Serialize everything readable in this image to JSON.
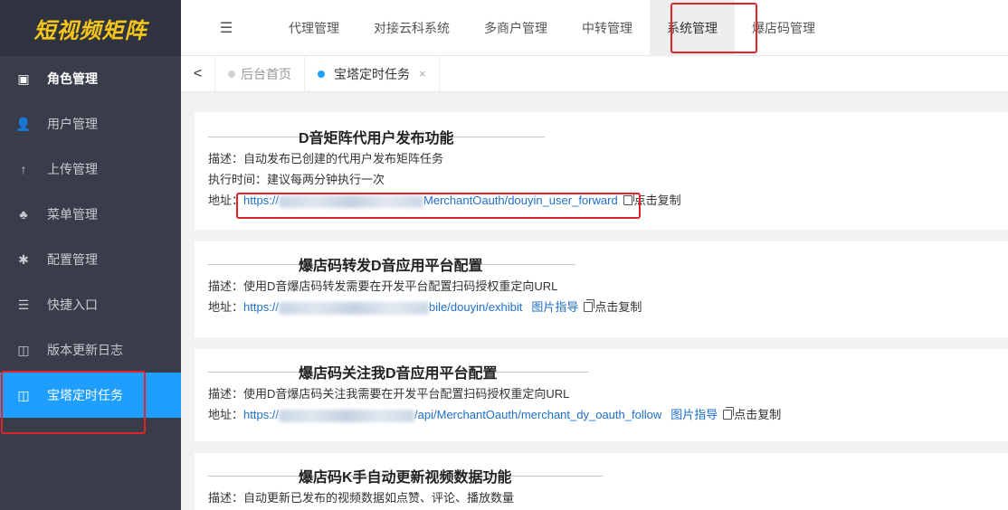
{
  "app": {
    "logo_text": "短视频矩阵"
  },
  "sidebar": {
    "items": [
      {
        "label": "角色管理",
        "icon": "id-card-icon",
        "glyph": "▣"
      },
      {
        "label": "用户管理",
        "icon": "user-icon",
        "glyph": "👤"
      },
      {
        "label": "上传管理",
        "icon": "upload-icon",
        "glyph": "↑"
      },
      {
        "label": "菜单管理",
        "icon": "tree-icon",
        "glyph": "♣"
      },
      {
        "label": "配置管理",
        "icon": "settings-icon",
        "glyph": "✱"
      },
      {
        "label": "快捷入口",
        "icon": "list-icon",
        "glyph": "☰"
      },
      {
        "label": "版本更新日志",
        "icon": "columns-icon",
        "glyph": "◫"
      },
      {
        "label": "宝塔定时任务",
        "icon": "columns-icon",
        "glyph": "◫"
      }
    ]
  },
  "topnav": {
    "toggle_glyph": "☰",
    "items": [
      {
        "label": "代理管理"
      },
      {
        "label": "对接云科系统"
      },
      {
        "label": "多商户管理"
      },
      {
        "label": "中转管理"
      },
      {
        "label": "系统管理"
      },
      {
        "label": "爆店码管理"
      }
    ]
  },
  "tabs": {
    "prev_glyph": "<",
    "items": [
      {
        "label": "后台首页"
      },
      {
        "label": "宝塔定时任务",
        "close": "×"
      }
    ]
  },
  "cards": [
    {
      "title": "D音矩阵代用户发布功能",
      "desc_label": "描述：",
      "desc": "自动发布已创建的代用户发布矩阵任务",
      "time_label": "执行时间：",
      "time": "建议每两分钟执行一次",
      "addr_label": "地址：",
      "url_prefix": "https://",
      "url_suffix": "MerchantOauth/douyin_user_forward",
      "copy_label": "点击复制"
    },
    {
      "title": "爆店码转发D音应用平台配置",
      "desc_label": "描述：",
      "desc": "使用D音爆店码转发需要在开发平台配置扫码授权重定向URL",
      "addr_label": "地址：",
      "url_prefix": "https://",
      "url_suffix": "bile/douyin/exhibit",
      "guide_label": "图片指导",
      "copy_label": "点击复制"
    },
    {
      "title": "爆店码关注我D音应用平台配置",
      "desc_label": "描述：",
      "desc": "使用D音爆店码关注我需要在开发平台配置扫码授权重定向URL",
      "addr_label": "地址：",
      "url_prefix": "https://",
      "url_suffix": "/api/MerchantOauth/merchant_dy_oauth_follow",
      "guide_label": "图片指导",
      "copy_label": "点击复制"
    },
    {
      "title": "爆店码K手自动更新视频数据功能",
      "desc_label": "描述：",
      "desc": "自动更新已发布的视频数据如点赞、评论、播放数量"
    }
  ],
  "colors": {
    "accent": "#1e9fff",
    "sidebar_bg": "#393d49",
    "logo": "#f5c518",
    "annotation": "#e0242b"
  }
}
